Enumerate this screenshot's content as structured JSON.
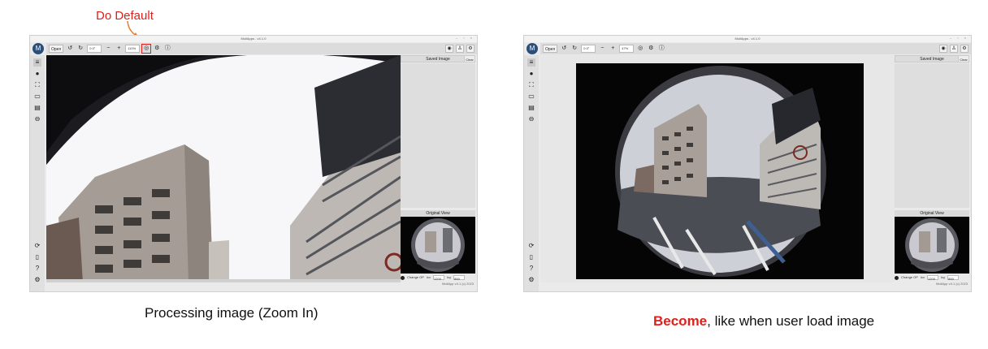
{
  "annotation": {
    "text": "Do Default"
  },
  "captions": {
    "left": "Processing image (Zoom In)",
    "right_emph": "Become",
    "right_rest": ", like when user load image"
  },
  "app": {
    "title": "MoilApps - v4.1.0",
    "window_controls": "– ▫ ×",
    "logo_glyph": "M",
    "toolbar": {
      "open_label": "Open",
      "rotate_left_icon": "↺",
      "rotate_right_icon": "↻",
      "angle_value": "0.0°",
      "zoom_out_label": "−",
      "zoom_in_label": "+",
      "default_icon": "◎",
      "info_icon": "ⓘ",
      "settings_icon": "⚙"
    },
    "right_buttons": [
      "◉",
      "♙",
      "⚙"
    ],
    "sidebar_icons": [
      "≡",
      "●",
      "⛶",
      "▭",
      "▤",
      "⊖",
      "⟳",
      "▯",
      "?",
      "⚙"
    ],
    "saved_image_label": "Saved Image",
    "clear_label": "Clear",
    "original_view_label": "Original View",
    "change_op_label": "Change OP",
    "icx_label": "Icx",
    "icx_value": "1200",
    "icy_label": "Icy",
    "icy_value": "850",
    "footer_text": "MoilApp v4.1 (c) 2023"
  },
  "screens": [
    {
      "id": "left",
      "zoom_value": "110%"
    },
    {
      "id": "right",
      "zoom_value": "47%"
    }
  ]
}
